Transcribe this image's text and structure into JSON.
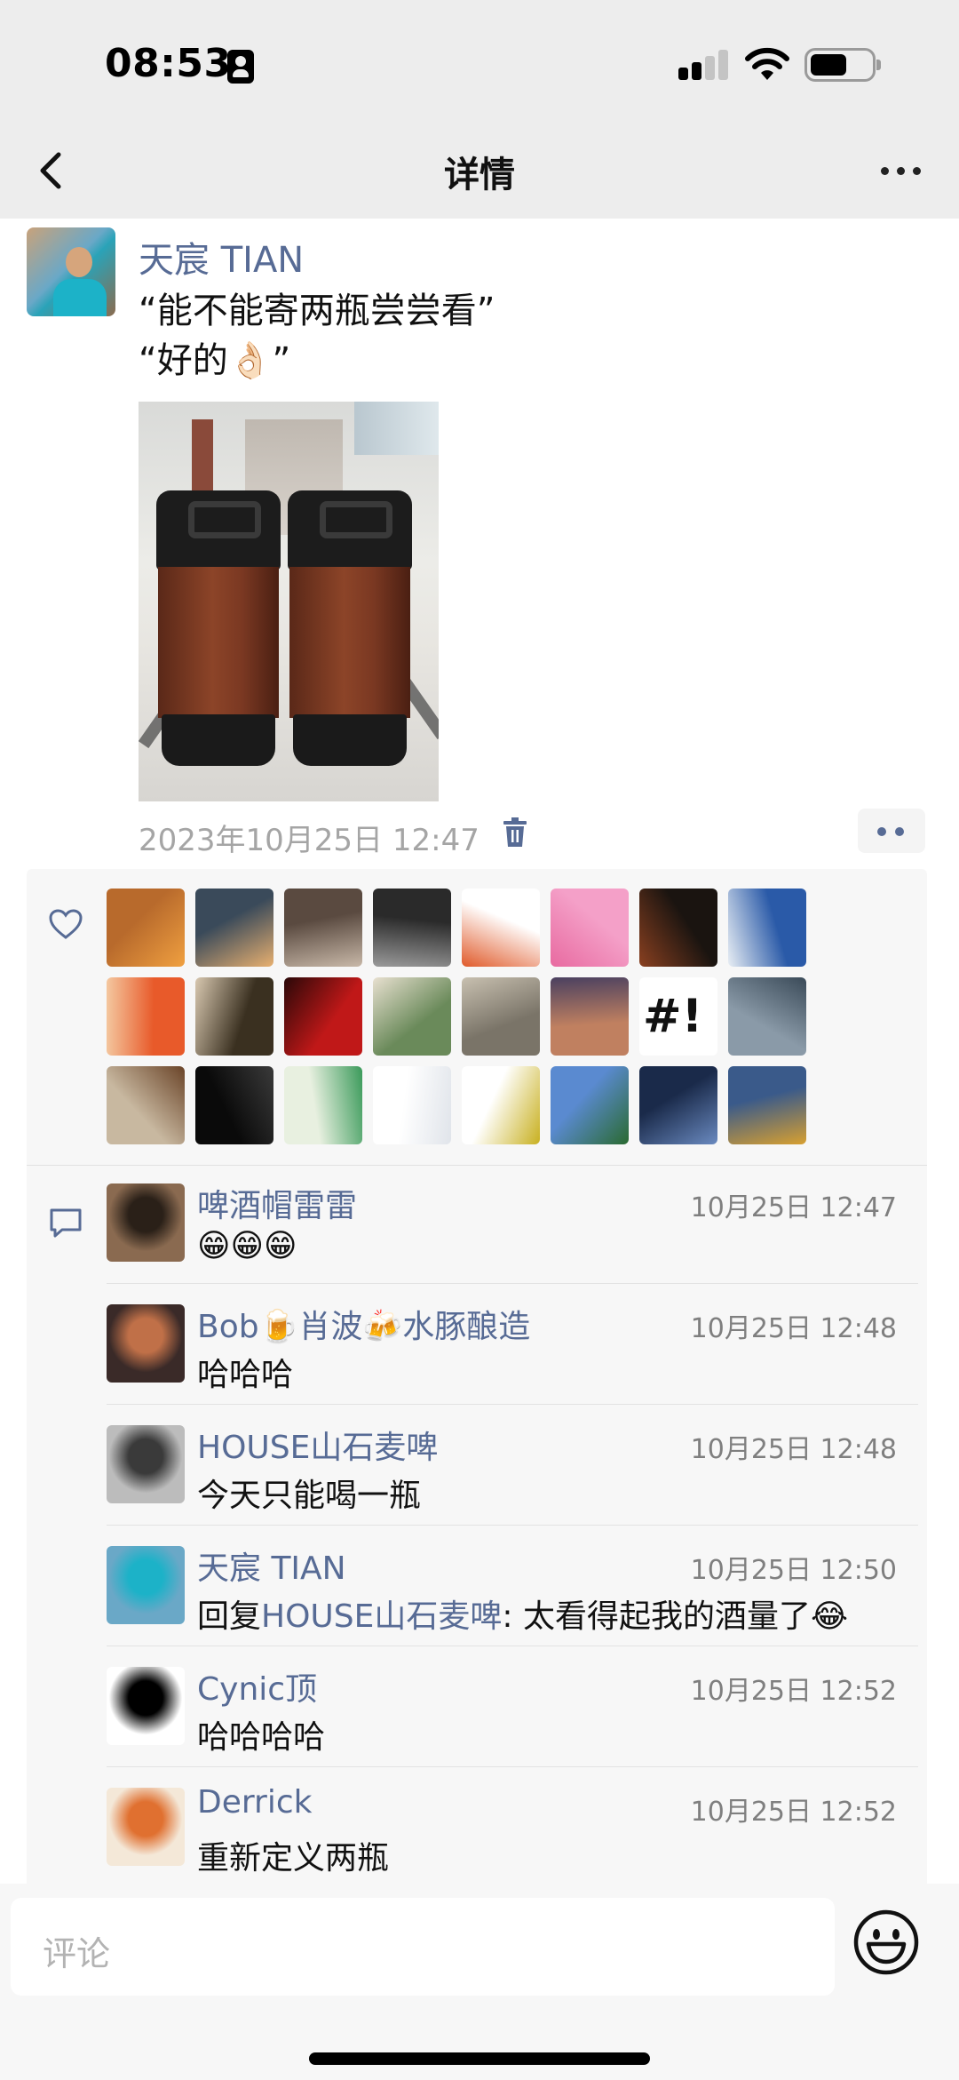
{
  "status_bar": {
    "time": "08:53"
  },
  "nav": {
    "title": "详情"
  },
  "post": {
    "author": "天宸 TIAN",
    "text": "“能不能寄两瓶尝尝看”\n“好的👌🏻”",
    "time": "2023年10月25日 12:47"
  },
  "likes": {
    "count": 24,
    "avatars": [
      {
        "icon": "beer-glass-avatar",
        "colors": [
          "#b86a2c",
          "#f0a040"
        ]
      },
      {
        "icon": "sunset-beach-avatar",
        "colors": [
          "#3a4a5a",
          "#e8b070"
        ]
      },
      {
        "icon": "group-photo-avatar",
        "colors": [
          "#5a4a40",
          "#c8b8a8"
        ]
      },
      {
        "icon": "bw-couple-avatar",
        "colors": [
          "#2a2a2a",
          "#9a9a9a"
        ]
      },
      {
        "icon": "cartoon-logo-avatar",
        "colors": [
          "#ffffff",
          "#e05a2a"
        ]
      },
      {
        "icon": "pink-square-avatar",
        "colors": [
          "#f4a0c8",
          "#e86aa0"
        ]
      },
      {
        "icon": "wine-glass-avatar",
        "colors": [
          "#1a1410",
          "#8a4020"
        ]
      },
      {
        "icon": "snow-mountain-avatar",
        "colors": [
          "#2a5aa8",
          "#e8eef4"
        ]
      },
      {
        "icon": "cartoon-face-avatar",
        "colors": [
          "#e85a2a",
          "#f4c8a0"
        ]
      },
      {
        "icon": "girl-portrait-avatar",
        "colors": [
          "#3a3020",
          "#d8c8b0"
        ]
      },
      {
        "icon": "red-stage-avatar",
        "colors": [
          "#c01818",
          "#2a0808"
        ]
      },
      {
        "icon": "girl-sunglasses-avatar",
        "colors": [
          "#6a8a5a",
          "#e8e0d0"
        ]
      },
      {
        "icon": "cat-goggles-avatar",
        "colors": [
          "#7a7468",
          "#c8c0b0"
        ]
      },
      {
        "icon": "street-night-avatar",
        "colors": [
          "#c08060",
          "#4a4060"
        ]
      },
      {
        "icon": "hash-bang-avatar",
        "colors": [
          "#ffffff",
          "#111111"
        ]
      },
      {
        "icon": "sea-view-avatar",
        "colors": [
          "#8a9aa8",
          "#3a4a58"
        ]
      },
      {
        "icon": "bear-avatar",
        "colors": [
          "#c8b8a0",
          "#6a4428"
        ]
      },
      {
        "icon": "night-cyclist-avatar",
        "colors": [
          "#0a0a0a",
          "#3a3a3a"
        ]
      },
      {
        "icon": "imagine-sign-avatar",
        "colors": [
          "#e8f0e0",
          "#3a9a5a"
        ]
      },
      {
        "icon": "white-feather-avatar",
        "colors": [
          "#ffffff",
          "#e0e4ea"
        ]
      },
      {
        "icon": "pineapple-avatar",
        "colors": [
          "#ffffff",
          "#c8b020"
        ]
      },
      {
        "icon": "tree-sky-avatar",
        "colors": [
          "#5a8ad0",
          "#2a6a30"
        ]
      },
      {
        "icon": "fantasy-warrior-avatar",
        "colors": [
          "#1a2a4a",
          "#6a8ac0"
        ]
      },
      {
        "icon": "robot-avatar",
        "colors": [
          "#3a5a8a",
          "#d8a030"
        ]
      }
    ]
  },
  "comments": [
    {
      "name": "啤酒帽雷雷",
      "time": "10月25日 12:47",
      "text": "😁😁😁",
      "avatar_colors": [
        "#8a6a50",
        "#2a2018"
      ],
      "avatar_icon": "man-portrait-avatar"
    },
    {
      "name": "Bob🍺肖波🍻水豚酿造",
      "time": "10月25日 12:48",
      "text": "哈哈哈",
      "avatar_colors": [
        "#3a2a28",
        "#c07048"
      ],
      "avatar_icon": "drinking-mural-avatar"
    },
    {
      "name": "HOUSE山石麦啤",
      "time": "10月25日 12:48",
      "text": "今天只能喝一瓶",
      "avatar_colors": [
        "#bcbcbc",
        "#3a3a3a"
      ],
      "avatar_icon": "man-drinking-avatar"
    },
    {
      "name": "天宸 TIAN",
      "time": "10月25日 12:50",
      "reply_prefix": "回复",
      "reply_to": "HOUSE山石麦啤",
      "text": ": 太看得起我的酒量了😂",
      "avatar_colors": [
        "#6aa8c7",
        "#1cb2c8"
      ],
      "avatar_icon": "man-blue-shirt-avatar"
    },
    {
      "name": "Cynic顶",
      "time": "10月25日 12:52",
      "text": "哈哈哈哈",
      "avatar_colors": [
        "#ffffff",
        "#000000"
      ],
      "avatar_icon": "black-circle-avatar"
    },
    {
      "name": "Derrick",
      "time": "10月25日 12:52",
      "text": "重新定义两瓶",
      "avatar_colors": [
        "#f4e8d8",
        "#e07030"
      ],
      "avatar_icon": "fox-avatar"
    }
  ],
  "comment_input": {
    "placeholder": "评论"
  },
  "icons": {
    "back": "chevron-left-icon",
    "more": "more-dots-icon",
    "trash": "trash-icon",
    "like": "heart-icon",
    "comment": "comment-bubble-icon",
    "emoji": "smiley-icon"
  },
  "colors": {
    "link": "#576b95",
    "bar": "#ededed",
    "box": "#f7f7f7"
  }
}
